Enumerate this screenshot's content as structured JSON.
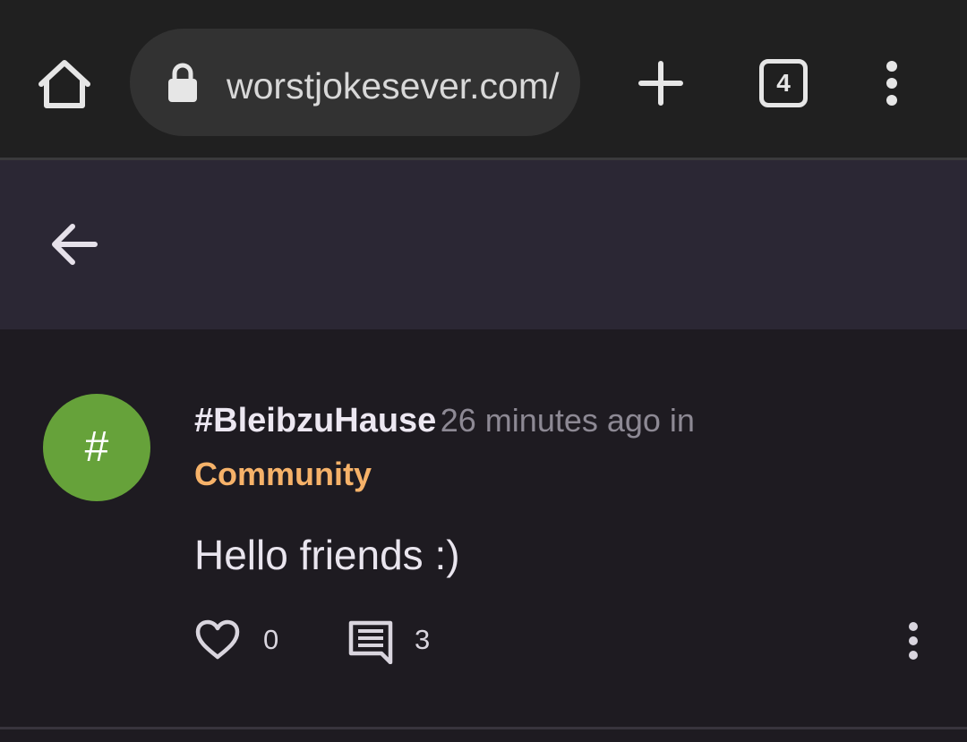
{
  "browser": {
    "url": "worstjokesever.com/",
    "tab_count": "4",
    "icons": {
      "home": "home-icon",
      "lock": "lock-icon",
      "new_tab": "plus-icon",
      "menu": "more-vert-icon"
    }
  },
  "header": {
    "back_icon": "arrow-left-icon"
  },
  "post": {
    "avatar_symbol": "#",
    "author": "#BleibzuHause",
    "meta": "26 minutes ago in",
    "community": "Community",
    "body": "Hello friends :)",
    "like_count": "0",
    "comment_count": "3",
    "icons": {
      "like": "heart-outline-icon",
      "comment": "comment-icon",
      "menu": "more-vert-icon"
    }
  },
  "colors": {
    "browser_bar": "#202020",
    "omnibox": "#323232",
    "app_header": "#2b2734",
    "background": "#1e1b21",
    "avatar": "#66a23a",
    "community_accent": "#f6b269",
    "meta_text": "#8d8994"
  }
}
